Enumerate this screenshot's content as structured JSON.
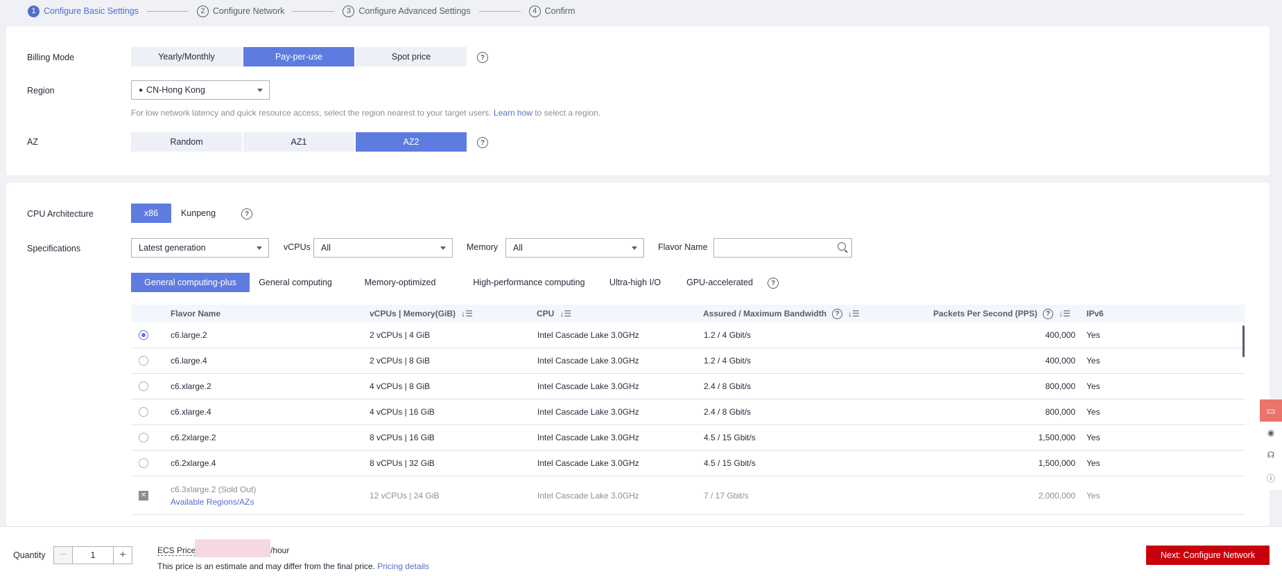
{
  "stepper": [
    {
      "num": "1",
      "label": "Configure Basic Settings"
    },
    {
      "num": "2",
      "label": "Configure Network"
    },
    {
      "num": "3",
      "label": "Configure Advanced Settings"
    },
    {
      "num": "4",
      "label": "Confirm"
    }
  ],
  "basic": {
    "billing_label": "Billing Mode",
    "billing_options": [
      "Yearly/Monthly",
      "Pay-per-use",
      "Spot price"
    ],
    "billing_selected": "Pay-per-use",
    "region_label": "Region",
    "region_value": "CN-Hong Kong",
    "region_hint_pre": "For low network latency and quick resource access, select the region nearest to your target users.",
    "region_hint_link": "Learn how",
    "region_hint_post": "to select a region.",
    "az_label": "AZ",
    "az_options": [
      "Random",
      "AZ1",
      "AZ2"
    ],
    "az_selected": "AZ2"
  },
  "spec": {
    "cpu_arch_label": "CPU Architecture",
    "cpu_arch_options": [
      "x86",
      "Kunpeng"
    ],
    "cpu_arch_selected": "x86",
    "spec_label": "Specifications",
    "generation_value": "Latest generation",
    "vcpus_label": "vCPUs",
    "vcpus_value": "All",
    "memory_label": "Memory",
    "memory_value": "All",
    "flavor_name_label": "Flavor Name",
    "flavor_name_value": "",
    "types": [
      "General computing-plus",
      "General computing",
      "Memory-optimized",
      "High-performance computing",
      "Ultra-high I/O",
      "GPU-accelerated"
    ],
    "type_selected": "General computing-plus"
  },
  "table": {
    "headers": {
      "flavor": "Flavor Name",
      "vcpu_mem": "vCPUs | Memory(GiB)",
      "cpu": "CPU",
      "bandwidth": "Assured / Maximum Bandwidth",
      "pps": "Packets Per Second (PPS)",
      "ipv6": "IPv6"
    },
    "rows": [
      {
        "flavor": "c6.large.2",
        "vcpu_mem": "2 vCPUs | 4 GiB",
        "cpu": "Intel Cascade Lake 3.0GHz",
        "bandwidth": "1.2 / 4 Gbit/s",
        "pps": "400,000",
        "ipv6": "Yes",
        "selected": true
      },
      {
        "flavor": "c6.large.4",
        "vcpu_mem": "2 vCPUs | 8 GiB",
        "cpu": "Intel Cascade Lake 3.0GHz",
        "bandwidth": "1.2 / 4 Gbit/s",
        "pps": "400,000",
        "ipv6": "Yes"
      },
      {
        "flavor": "c6.xlarge.2",
        "vcpu_mem": "4 vCPUs | 8 GiB",
        "cpu": "Intel Cascade Lake 3.0GHz",
        "bandwidth": "2.4 / 8 Gbit/s",
        "pps": "800,000",
        "ipv6": "Yes"
      },
      {
        "flavor": "c6.xlarge.4",
        "vcpu_mem": "4 vCPUs | 16 GiB",
        "cpu": "Intel Cascade Lake 3.0GHz",
        "bandwidth": "2.4 / 8 Gbit/s",
        "pps": "800,000",
        "ipv6": "Yes"
      },
      {
        "flavor": "c6.2xlarge.2",
        "vcpu_mem": "8 vCPUs | 16 GiB",
        "cpu": "Intel Cascade Lake 3.0GHz",
        "bandwidth": "4.5 / 15 Gbit/s",
        "pps": "1,500,000",
        "ipv6": "Yes"
      },
      {
        "flavor": "c6.2xlarge.4",
        "vcpu_mem": "8 vCPUs | 32 GiB",
        "cpu": "Intel Cascade Lake 3.0GHz",
        "bandwidth": "4.5 / 15 Gbit/s",
        "pps": "1,500,000",
        "ipv6": "Yes"
      },
      {
        "flavor": "c6.3xlarge.2 (Sold Out)",
        "flavor_link": "Available Regions/AZs",
        "vcpu_mem": "12 vCPUs | 24 GiB",
        "cpu": "Intel Cascade Lake 3.0GHz",
        "bandwidth": "7 / 17 Gbit/s",
        "pps": "2,000,000",
        "ipv6": "Yes",
        "sold_out": true
      }
    ]
  },
  "bottom": {
    "quantity_label": "Quantity",
    "quantity_value": "1",
    "price_label": "ECS Price",
    "price_unit": "/hour",
    "price_note": "This price is an estimate and may differ from the final price.",
    "price_link": "Pricing details",
    "next_label": "Next: Configure Network"
  },
  "icons": {
    "help": "question-circle-icon",
    "location": "map-pin-icon",
    "search": "search-icon",
    "sort": "sort-icon",
    "cart": "cart-icon"
  },
  "colors": {
    "accent": "#5e7ce0",
    "primary_action": "#c7000b",
    "link": "#526ecc"
  }
}
